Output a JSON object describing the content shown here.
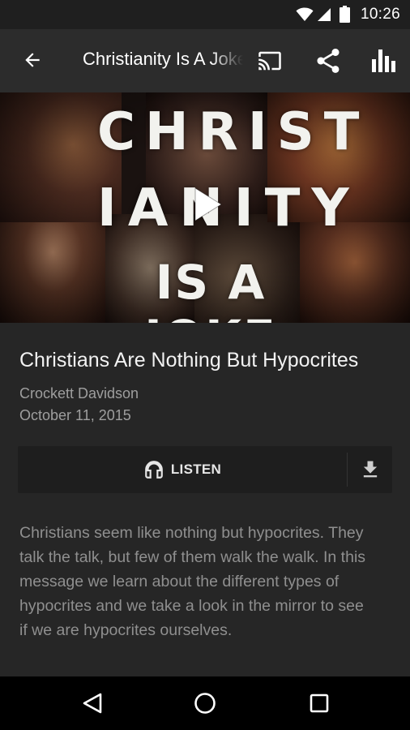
{
  "status_bar": {
    "time": "10:26"
  },
  "app_bar": {
    "title": "Christianity Is A Joke",
    "icons": [
      "back-arrow-icon",
      "cast-icon",
      "share-icon",
      "equalizer-icon"
    ]
  },
  "hero": {
    "overlay_lines": [
      "CHRIST",
      "IANITY",
      "IS A JOKE"
    ],
    "play_icon": "play-icon"
  },
  "sermon": {
    "title": "Christians Are Nothing But Hypocrites",
    "speaker": "Crockett Davidson",
    "date": "October 11, 2015",
    "listen_label": "LISTEN",
    "description": "Christians seem like nothing but hypocrites. They talk the talk, but few of them walk the walk. In this message we learn about the different types of hypocrites and we take a look in the mirror to see if we are hypocrites ourselves."
  },
  "colors": {
    "app_bar": "#2c2c2c",
    "background": "#262626",
    "listen_bar": "#1e1e1e",
    "secondary_text": "#9e9e9e"
  }
}
